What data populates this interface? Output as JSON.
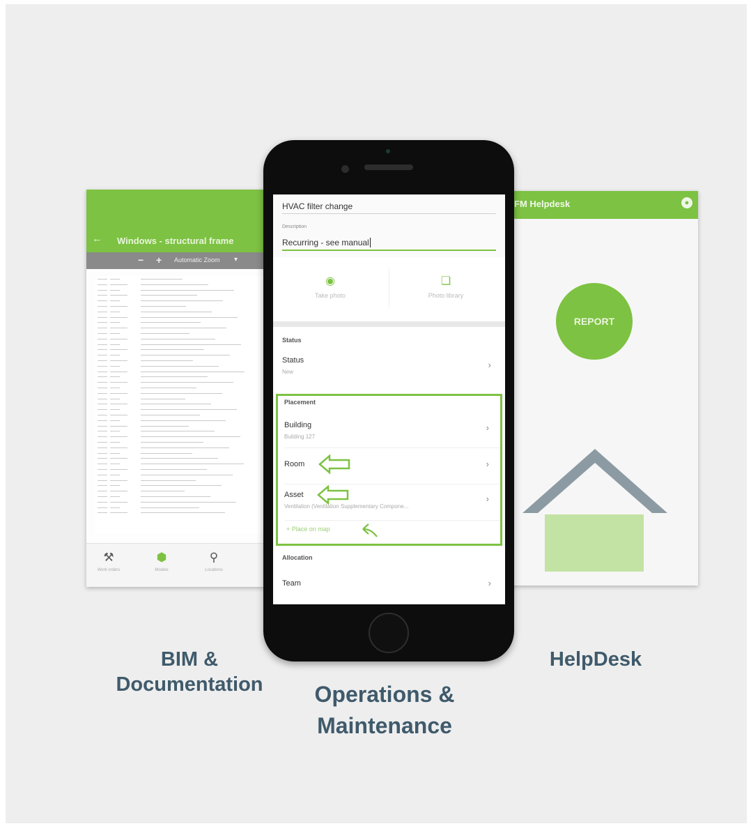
{
  "bim_panel": {
    "title": "Windows - structural frame",
    "zoom_label": "Automatic Zoom",
    "nav": [
      {
        "icon": "tools-icon",
        "label": "Work orders"
      },
      {
        "icon": "model-icon",
        "label": "Models"
      },
      {
        "icon": "location-icon",
        "label": "Locations"
      }
    ]
  },
  "helpdesk_panel": {
    "title": "FM Helpdesk",
    "report_label": "REPORT"
  },
  "phone_form": {
    "title_value": "HVAC filter change",
    "description_label": "Description",
    "description_value": "Recurring - see manual",
    "take_photo_label": "Take photo",
    "photo_library_label": "Photo library",
    "status_section": "Status",
    "status_row": {
      "title": "Status",
      "value": "New"
    },
    "placement_section": "Placement",
    "building_row": {
      "title": "Building",
      "value": "Building 127"
    },
    "room_row": {
      "title": "Room"
    },
    "asset_row": {
      "title": "Asset",
      "value": "Ventilation (Ventilation Supplementary Compone..."
    },
    "place_on_map_label": "+ Place on map",
    "allocation_section": "Allocation",
    "team_row": {
      "title": "Team"
    }
  },
  "captions": {
    "bim_line1": "BIM &",
    "bim_line2": "Documentation",
    "ops_line1": "Operations &",
    "ops_line2": "Maintenance",
    "helpdesk": "HelpDesk"
  },
  "colors": {
    "accent_green": "#7dc242",
    "caption_blue": "#3f5a6b",
    "house_roof": "#8c9ba3",
    "house_body": "#c3e3a4"
  }
}
